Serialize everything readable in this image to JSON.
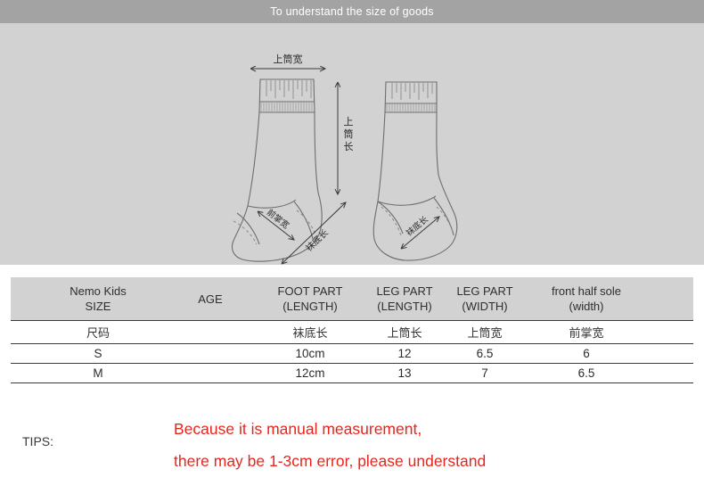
{
  "header": {
    "title": "To understand the size of goods"
  },
  "diagram": {
    "labels": {
      "leg_width": "上筒宽",
      "leg_length": "上筒长",
      "front_sole_width": "前掌宽",
      "sole_length": "袜底长",
      "right_sock_label": "袜底长"
    }
  },
  "table": {
    "columns": [
      {
        "line1": "Nemo Kids",
        "line2": "SIZE"
      },
      {
        "line1": "AGE",
        "line2": ""
      },
      {
        "line1": "FOOT PART",
        "line2": "(LENGTH)"
      },
      {
        "line1": "LEG PART",
        "line2": "(LENGTH)"
      },
      {
        "line1": "LEG PART",
        "line2": "(WIDTH)"
      },
      {
        "line1": "front half sole",
        "line2": "(width)"
      }
    ],
    "cn_row": [
      "尺码",
      "",
      "袜底长",
      "上筒长",
      "上筒宽",
      "前掌宽"
    ],
    "rows": [
      {
        "size": "S",
        "age": "",
        "foot_length": "10cm",
        "leg_length": "12",
        "leg_width": "6.5",
        "front_half_sole": "6"
      },
      {
        "size": "M",
        "age": "",
        "foot_length": "12cm",
        "leg_length": "13",
        "leg_width": "7",
        "front_half_sole": "6.5"
      }
    ]
  },
  "tips": {
    "label": "TIPS:",
    "line1": "Because it is manual measurement,",
    "line2": "there may be 1-3cm error, please understand"
  },
  "colors": {
    "title_bar": "#a3a3a3",
    "panel_bg": "#d2d2d2",
    "tips_red": "#e8251c",
    "rule": "#3c3c3c"
  }
}
